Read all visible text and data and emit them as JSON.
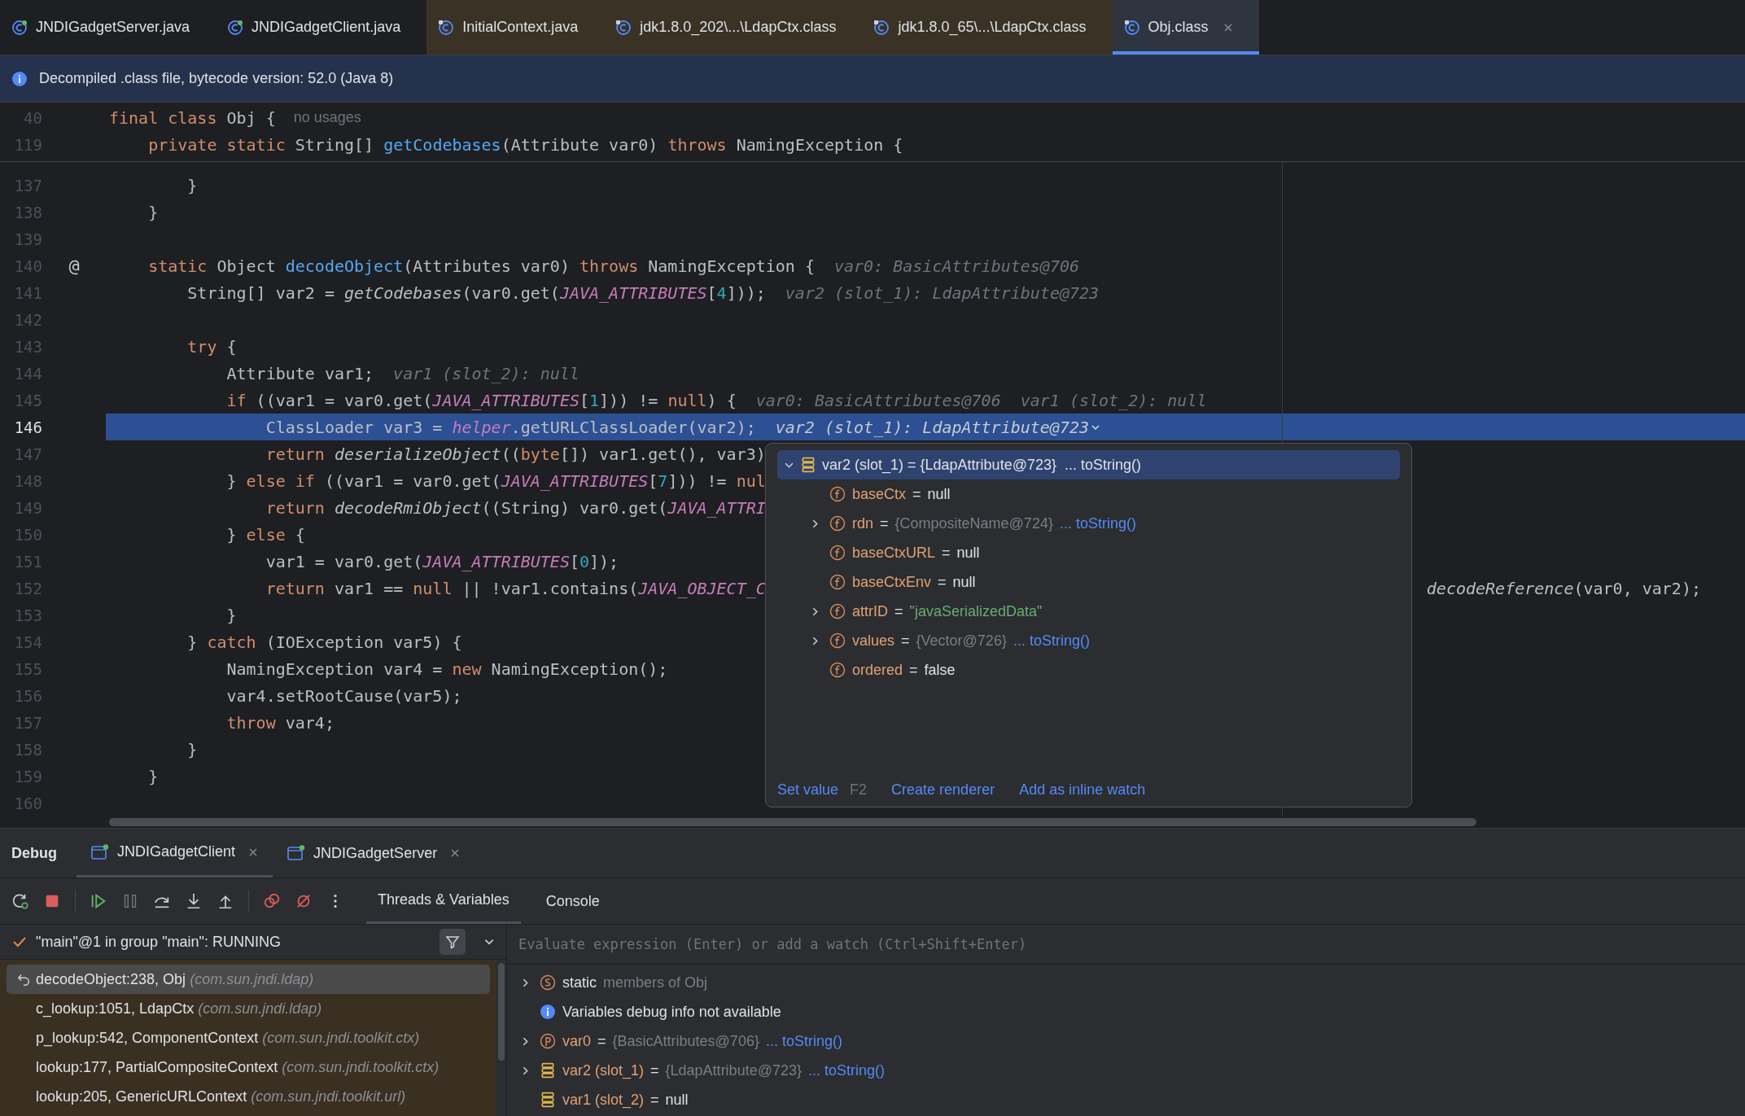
{
  "editor_tabs": [
    {
      "label": "JNDIGadgetServer.java",
      "kind": "source",
      "library": false,
      "selected": false,
      "close_button": false
    },
    {
      "label": "JNDIGadgetClient.java",
      "kind": "source",
      "library": false,
      "selected": false,
      "close_button": false
    },
    {
      "label": "InitialContext.java",
      "kind": "compiled",
      "library": true,
      "selected": false,
      "close_button": false
    },
    {
      "label": "jdk1.8.0_202\\...\\LdapCtx.class",
      "kind": "compiled",
      "library": true,
      "selected": false,
      "close_button": false
    },
    {
      "label": "jdk1.8.0_65\\...\\LdapCtx.class",
      "kind": "compiled",
      "library": true,
      "selected": false,
      "close_button": false
    },
    {
      "label": "Obj.class",
      "kind": "compiled",
      "library": false,
      "selected": true,
      "close_button": true
    }
  ],
  "banner": {
    "text": "Decompiled .class file, bytecode version: 52.0 (Java 8)"
  },
  "editor": {
    "sticky_lines": [
      {
        "number": "40",
        "tokens": [
          {
            "kind": "keyword",
            "text": "final class"
          },
          {
            "kind": "plain",
            "text": " Obj {"
          }
        ],
        "hints": [
          {
            "kind": "usages",
            "text": "no usages"
          }
        ]
      },
      {
        "number": "119",
        "tokens": [
          {
            "kind": "keyword",
            "text": "    private static"
          },
          {
            "kind": "plain",
            "text": " String[] "
          },
          {
            "kind": "declaration",
            "text": "getCodebases"
          },
          {
            "kind": "plain",
            "text": "(Attribute var0) "
          },
          {
            "kind": "keyword",
            "text": "throws"
          },
          {
            "kind": "plain",
            "text": " NamingException {"
          }
        ]
      }
    ],
    "lines": [
      {
        "number": "137",
        "tokens": [
          {
            "kind": "plain",
            "text": "        }"
          }
        ],
        "selected": false
      },
      {
        "number": "138",
        "tokens": [
          {
            "kind": "plain",
            "text": "    }"
          }
        ],
        "selected": false
      },
      {
        "number": "139",
        "selected": false
      },
      {
        "number": "140",
        "gutter_mark": "@",
        "tokens": [
          {
            "kind": "keyword",
            "text": "    static"
          },
          {
            "kind": "plain",
            "text": " Object "
          },
          {
            "kind": "declaration",
            "text": "decodeObject"
          },
          {
            "kind": "plain",
            "text": "(Attributes var0) "
          },
          {
            "kind": "keyword",
            "text": "throws"
          },
          {
            "kind": "plain",
            "text": " NamingException {"
          }
        ],
        "hints": [
          {
            "kind": "value",
            "text": "var0: BasicAttributes@706"
          }
        ],
        "selected": false
      },
      {
        "number": "141",
        "tokens": [
          {
            "kind": "plain",
            "text": "        String[] var2 = "
          },
          {
            "kind": "call",
            "text": "getCodebases"
          },
          {
            "kind": "plain",
            "text": "(var0.get("
          },
          {
            "kind": "constant",
            "text": "JAVA_ATTRIBUTES"
          },
          {
            "kind": "plain",
            "text": "["
          },
          {
            "kind": "number",
            "text": "4"
          },
          {
            "kind": "plain",
            "text": "]));"
          }
        ],
        "hints": [
          {
            "kind": "value",
            "text": "var2 (slot_1): LdapAttribute@723"
          }
        ],
        "selected": false
      },
      {
        "number": "142",
        "selected": false
      },
      {
        "number": "143",
        "tokens": [
          {
            "kind": "keyword",
            "text": "        try"
          },
          {
            "kind": "plain",
            "text": " {"
          }
        ],
        "selected": false
      },
      {
        "number": "144",
        "tokens": [
          {
            "kind": "plain",
            "text": "            Attribute var1;"
          }
        ],
        "hints": [
          {
            "kind": "value",
            "text": "var1 (slot_2): null"
          }
        ],
        "selected": false
      },
      {
        "number": "145",
        "tokens": [
          {
            "kind": "keyword",
            "text": "            if"
          },
          {
            "kind": "plain",
            "text": " ((var1 = var0.get("
          },
          {
            "kind": "constant",
            "text": "JAVA_ATTRIBUTES"
          },
          {
            "kind": "plain",
            "text": "["
          },
          {
            "kind": "number",
            "text": "1"
          },
          {
            "kind": "plain",
            "text": "])) != "
          },
          {
            "kind": "keyword",
            "text": "null"
          },
          {
            "kind": "plain",
            "text": ") {"
          }
        ],
        "hints": [
          {
            "kind": "value",
            "text": "var0: BasicAttributes@706"
          },
          {
            "kind": "value",
            "text": "var1 (slot_2): null"
          }
        ],
        "selected": false
      },
      {
        "number": "146",
        "tokens": [
          {
            "kind": "plain",
            "text": "                ClassLoader var3 = "
          },
          {
            "kind": "constant",
            "text": "helper"
          },
          {
            "kind": "plain",
            "text": ".getURLClassLoader(var2);"
          }
        ],
        "hints": [
          {
            "kind": "dropdown",
            "text": "var2 (slot_1): LdapAttribute@723"
          }
        ],
        "selected": true
      },
      {
        "number": "147",
        "tokens": [
          {
            "kind": "keyword",
            "text": "                return"
          },
          {
            "kind": "call",
            "text": " deserializeObject"
          },
          {
            "kind": "plain",
            "text": "(("
          },
          {
            "kind": "keyword",
            "text": "byte"
          },
          {
            "kind": "plain",
            "text": "[]) var1.get(), var3)"
          }
        ],
        "selected": false
      },
      {
        "number": "148",
        "tokens": [
          {
            "kind": "plain",
            "text": "            } "
          },
          {
            "kind": "keyword",
            "text": "else if"
          },
          {
            "kind": "plain",
            "text": " ((var1 = var0.get("
          },
          {
            "kind": "constant",
            "text": "JAVA_ATTRIBUTES"
          },
          {
            "kind": "plain",
            "text": "["
          },
          {
            "kind": "number",
            "text": "7"
          },
          {
            "kind": "plain",
            "text": "])) != "
          },
          {
            "kind": "keyword",
            "text": "nul"
          }
        ],
        "selected": false
      },
      {
        "number": "149",
        "tokens": [
          {
            "kind": "keyword",
            "text": "                return"
          },
          {
            "kind": "call",
            "text": " decodeRmiObject"
          },
          {
            "kind": "plain",
            "text": "((String) var0.get("
          },
          {
            "kind": "constant",
            "text": "JAVA_ATTRI"
          }
        ],
        "selected": false
      },
      {
        "number": "150",
        "tokens": [
          {
            "kind": "plain",
            "text": "            } "
          },
          {
            "kind": "keyword",
            "text": "else"
          },
          {
            "kind": "plain",
            "text": " {"
          }
        ],
        "selected": false
      },
      {
        "number": "151",
        "tokens": [
          {
            "kind": "plain",
            "text": "                var1 = var0.get("
          },
          {
            "kind": "constant",
            "text": "JAVA_ATTRIBUTES"
          },
          {
            "kind": "plain",
            "text": "["
          },
          {
            "kind": "number",
            "text": "0"
          },
          {
            "kind": "plain",
            "text": "]);"
          }
        ],
        "selected": false
      },
      {
        "number": "152",
        "tokens": [
          {
            "kind": "keyword",
            "text": "                return"
          },
          {
            "kind": "plain",
            "text": " var1 == "
          },
          {
            "kind": "keyword",
            "text": "null"
          },
          {
            "kind": "plain",
            "text": " || !var1.contains("
          },
          {
            "kind": "constant",
            "text": "JAVA_OBJECT_C"
          }
        ],
        "tail": [
          {
            "kind": "call",
            "text": "decodeReference"
          },
          {
            "kind": "plain",
            "text": "(var0, var2);"
          }
        ],
        "selected": false
      },
      {
        "number": "153",
        "tokens": [
          {
            "kind": "plain",
            "text": "            }"
          }
        ],
        "selected": false
      },
      {
        "number": "154",
        "tokens": [
          {
            "kind": "plain",
            "text": "        } "
          },
          {
            "kind": "keyword",
            "text": "catch"
          },
          {
            "kind": "plain",
            "text": " (IOException var5) {"
          }
        ],
        "selected": false
      },
      {
        "number": "155",
        "tokens": [
          {
            "kind": "plain",
            "text": "            NamingException var4 = "
          },
          {
            "kind": "keyword",
            "text": "new"
          },
          {
            "kind": "plain",
            "text": " NamingException();"
          }
        ],
        "selected": false
      },
      {
        "number": "156",
        "tokens": [
          {
            "kind": "plain",
            "text": "            var4.setRootCause(var5);"
          }
        ],
        "selected": false
      },
      {
        "number": "157",
        "tokens": [
          {
            "kind": "keyword",
            "text": "            throw"
          },
          {
            "kind": "plain",
            "text": " var4;"
          }
        ],
        "selected": false
      },
      {
        "number": "158",
        "tokens": [
          {
            "kind": "plain",
            "text": "        }"
          }
        ],
        "selected": false
      },
      {
        "number": "159",
        "tokens": [
          {
            "kind": "plain",
            "text": "    }"
          }
        ],
        "selected": false
      },
      {
        "number": "160",
        "selected": false
      }
    ]
  },
  "value_popup": {
    "root": {
      "name": "var2 (slot_1)",
      "operator": "=",
      "value": "{LdapAttribute@723}",
      "link": "... toString()",
      "expanded": true,
      "selected": true
    },
    "fields": [
      {
        "name": "baseCtx",
        "operator": "=",
        "value": "null",
        "kind": "literal",
        "expandable": false
      },
      {
        "name": "rdn",
        "operator": "=",
        "value": "{CompositeName@724}",
        "link": "... toString()",
        "kind": "object",
        "expandable": true
      },
      {
        "name": "baseCtxURL",
        "operator": "=",
        "value": "null",
        "kind": "literal",
        "expandable": false
      },
      {
        "name": "baseCtxEnv",
        "operator": "=",
        "value": "null",
        "kind": "literal",
        "expandable": false
      },
      {
        "name": "attrID",
        "operator": "=",
        "value": "\"javaSerializedData\"",
        "kind": "string",
        "expandable": true
      },
      {
        "name": "values",
        "operator": "=",
        "value": "{Vector@726}",
        "link": "... toString()",
        "kind": "object",
        "expandable": true
      },
      {
        "name": "ordered",
        "operator": "=",
        "value": "false",
        "kind": "literal",
        "expandable": false
      }
    ],
    "actions": [
      {
        "label": "Set value",
        "shortcut": "F2"
      },
      {
        "label": "Create renderer"
      },
      {
        "label": "Add as inline watch"
      }
    ]
  },
  "debug": {
    "title": "Debug",
    "sessions": [
      {
        "label": "JNDIGadgetClient",
        "selected": true
      },
      {
        "label": "JNDIGadgetServer",
        "selected": false
      }
    ],
    "view_tabs": [
      {
        "label": "Threads & Variables",
        "selected": true
      },
      {
        "label": "Console",
        "selected": false
      }
    ],
    "thread": {
      "text": "\"main\"@1 in group \"main\": RUNNING"
    },
    "frames": [
      {
        "method": "decodeObject:238, Obj",
        "package": "(com.sun.jndi.ldap)",
        "current": true,
        "selected": true
      },
      {
        "method": "c_lookup:1051, LdapCtx",
        "package": "(com.sun.jndi.ldap)",
        "current": false,
        "selected": false
      },
      {
        "method": "p_lookup:542, ComponentContext",
        "package": "(com.sun.jndi.toolkit.ctx)",
        "current": false,
        "selected": false
      },
      {
        "method": "lookup:177, PartialCompositeContext",
        "package": "(com.sun.jndi.toolkit.ctx)",
        "current": false,
        "selected": false
      },
      {
        "method": "lookup:205, GenericURLContext",
        "package": "(com.sun.jndi.toolkit.url)",
        "current": false,
        "selected": false
      }
    ],
    "evaluate": {
      "placeholder": "Evaluate expression (Enter) or add a watch (Ctrl+Shift+Enter)"
    },
    "variables": [
      {
        "kind": "static",
        "name": "static",
        "detail": "members of Obj",
        "expandable": true
      },
      {
        "kind": "info",
        "name": "Variables debug info not available",
        "expandable": false
      },
      {
        "kind": "parameter",
        "name": "var0",
        "operator": "=",
        "value": "{BasicAttributes@706}",
        "link": "... toString()",
        "expandable": true
      },
      {
        "kind": "local",
        "name": "var2 (slot_1)",
        "operator": "=",
        "value": "{LdapAttribute@723}",
        "link": "... toString()",
        "expandable": true
      },
      {
        "kind": "local",
        "name": "var1 (slot_2)",
        "operator": "=",
        "value": "null",
        "expandable": false
      }
    ]
  }
}
